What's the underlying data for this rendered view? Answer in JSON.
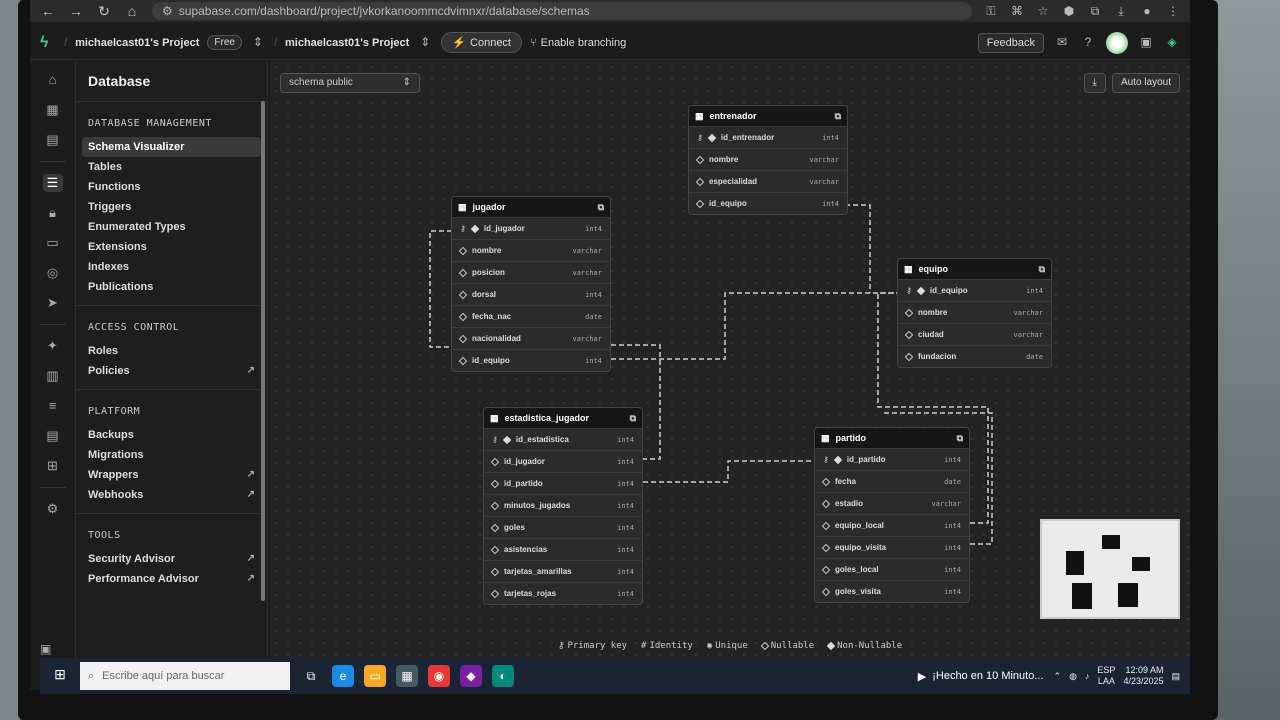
{
  "browser": {
    "url": "supabase.com/dashboard/project/jvkorkanoommcdvimnxr/database/schemas"
  },
  "header": {
    "org": "michaelcast01's Project",
    "plan": "Free",
    "project": "michaelcast01's Project",
    "connect": "Connect",
    "branching": "Enable branching",
    "feedback": "Feedback"
  },
  "menu": {
    "title": "Database",
    "sections": [
      {
        "head": "DATABASE MANAGEMENT",
        "items": [
          "Schema Visualizer",
          "Tables",
          "Functions",
          "Triggers",
          "Enumerated Types",
          "Extensions",
          "Indexes",
          "Publications"
        ]
      },
      {
        "head": "ACCESS CONTROL",
        "items": [
          "Roles",
          "Policies"
        ]
      },
      {
        "head": "PLATFORM",
        "items": [
          "Backups",
          "Migrations",
          "Wrappers",
          "Webhooks"
        ]
      },
      {
        "head": "TOOLS",
        "items": [
          "Security Advisor",
          "Performance Advisor"
        ]
      }
    ]
  },
  "canvas": {
    "schema": "schema public",
    "auto_layout": "Auto layout",
    "legend": [
      "Primary key",
      "Identity",
      "Unique",
      "Nullable",
      "Non-Nullable"
    ]
  },
  "tables": {
    "entrenador": {
      "name": "entrenador",
      "columns": [
        {
          "name": "id_entrenador",
          "type": "int4"
        },
        {
          "name": "nombre",
          "type": "varchar"
        },
        {
          "name": "especialidad",
          "type": "varchar"
        },
        {
          "name": "id_equipo",
          "type": "int4"
        }
      ]
    },
    "jugador": {
      "name": "jugador",
      "columns": [
        {
          "name": "id_jugador",
          "type": "int4"
        },
        {
          "name": "nombre",
          "type": "varchar"
        },
        {
          "name": "posicion",
          "type": "varchar"
        },
        {
          "name": "dorsal",
          "type": "int4"
        },
        {
          "name": "fecha_nac",
          "type": "date"
        },
        {
          "name": "nacionalidad",
          "type": "varchar"
        },
        {
          "name": "id_equipo",
          "type": "int4"
        }
      ]
    },
    "equipo": {
      "name": "equipo",
      "columns": [
        {
          "name": "id_equipo",
          "type": "int4"
        },
        {
          "name": "nombre",
          "type": "varchar"
        },
        {
          "name": "ciudad",
          "type": "varchar"
        },
        {
          "name": "fundacion",
          "type": "date"
        }
      ]
    },
    "estadistica": {
      "name": "estadistica_jugador",
      "columns": [
        {
          "name": "id_estadistica",
          "type": "int4"
        },
        {
          "name": "id_jugador",
          "type": "int4"
        },
        {
          "name": "id_partido",
          "type": "int4"
        },
        {
          "name": "minutos_jugados",
          "type": "int4"
        },
        {
          "name": "goles",
          "type": "int4"
        },
        {
          "name": "asistencias",
          "type": "int4"
        },
        {
          "name": "tarjetas_amarillas",
          "type": "int4"
        },
        {
          "name": "tarjetas_rojas",
          "type": "int4"
        }
      ]
    },
    "partido": {
      "name": "partido",
      "columns": [
        {
          "name": "id_partido",
          "type": "int4"
        },
        {
          "name": "fecha",
          "type": "date"
        },
        {
          "name": "estadio",
          "type": "varchar"
        },
        {
          "name": "equipo_local",
          "type": "int4"
        },
        {
          "name": "equipo_visita",
          "type": "int4"
        },
        {
          "name": "goles_local",
          "type": "int4"
        },
        {
          "name": "goles_visita",
          "type": "int4"
        }
      ]
    }
  },
  "taskbar": {
    "search_placeholder": "Escribe aquí para buscar",
    "news": "¡Hecho en 10 Minuto...",
    "lang1": "ESP",
    "lang2": "LAA",
    "time": "12:09 AM",
    "date": "4/23/2025"
  }
}
